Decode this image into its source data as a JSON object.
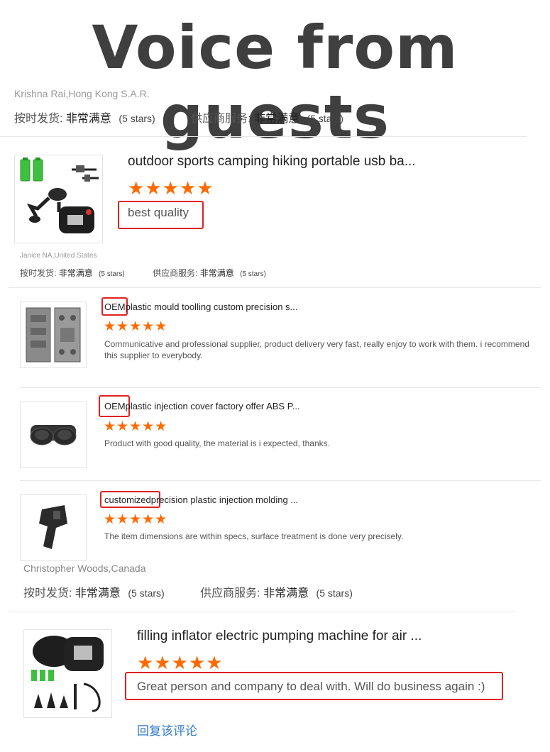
{
  "page": {
    "title": "Voice from guests"
  },
  "label_ontime": "按时发货:",
  "label_service": "供应商服务:",
  "label_satisfied": "非常满意",
  "label_stars": "(5 stars)",
  "colors": {
    "accent_star": "#ff6a00",
    "highlight_box": "#e02020",
    "link": "#2f7ad0"
  },
  "reviews": [
    {
      "reviewer": "Krishna Rai,Hong Kong S.A.R.",
      "product_title": "outdoor sports camping hiking portable usb ba...",
      "stars": "★★★★★",
      "comment": "best quality",
      "icon": "air-pump-usb-image"
    },
    {
      "reviewer": "Janice NA,United States",
      "items": [
        {
          "highlight": "OEM",
          "product_title": "plastic mould toolling custom precision s...",
          "stars": "★★★★★",
          "comment": "Communicative and professional supplier, product delivery very fast, really enjoy to work with them. i recommend this supplier to everybody.",
          "icon": "mould-image"
        },
        {
          "highlight": "OEM",
          "product_title": "plastic injection cover factory offer ABS P...",
          "stars": "★★★★★",
          "comment": "Product with good quality, the material is i expected, thanks.",
          "icon": "cup-holder-image"
        },
        {
          "highlight": "customized",
          "product_title": "precision plastic injection molding ...",
          "stars": "★★★★★",
          "comment": "The item dimensions are within specs, surface treatment is done very precisely.",
          "icon": "plastic-part-image"
        }
      ]
    },
    {
      "reviewer": "Christopher Woods,Canada",
      "product_title": "filling inflator electric pumping machine for air ...",
      "stars": "★★★★★",
      "comment": "Great person and company to deal with.  Will do business again :)",
      "reply_link": "回复该评论",
      "icon": "air-pump-image"
    }
  ]
}
